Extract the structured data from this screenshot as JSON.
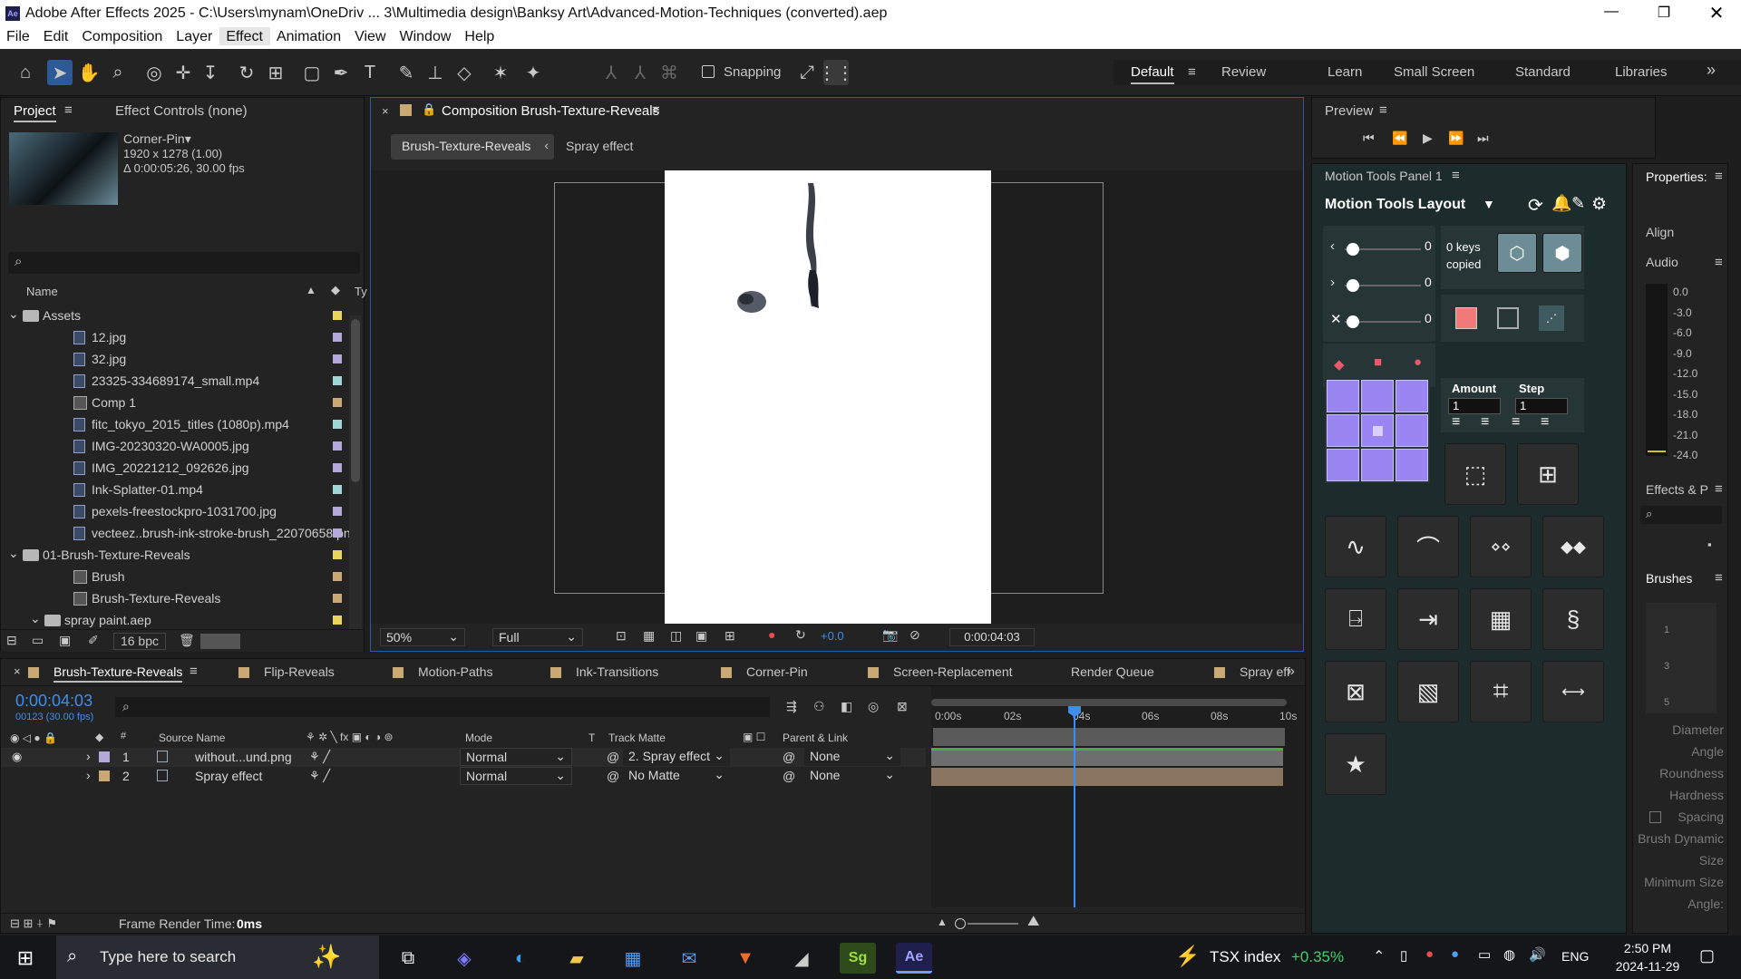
{
  "window": {
    "title": "Adobe After Effects 2025 - C:\\Users\\mynam\\OneDriv ... 3\\Multimedia design\\Banksy Art\\Advanced-Motion-Techniques (converted).aep",
    "app_badge": "Ae"
  },
  "menu": [
    "File",
    "Edit",
    "Composition",
    "Layer",
    "Effect",
    "Animation",
    "View",
    "Window",
    "Help"
  ],
  "toolbar": {
    "snapping": "Snapping"
  },
  "workspaces": [
    "Default",
    "Review",
    "Learn",
    "Small Screen",
    "Standard",
    "Libraries"
  ],
  "project": {
    "tab_project": "Project",
    "tab_effect": "Effect Controls (none)",
    "item_name": "Corner-Pin▾",
    "item_dims": "1920 x 1278 (1.00)",
    "item_dur": "Δ 0:00:05:26, 30.00 fps",
    "search_placeholder": "",
    "col_name": "Name",
    "col_type": "Ty",
    "rows": [
      {
        "label": "Assets",
        "color": "#e8d55a",
        "type": "folder",
        "indent": 0
      },
      {
        "label": "12.jpg",
        "color": "#b3a9d9",
        "type": "file",
        "indent": 2
      },
      {
        "label": "32.jpg",
        "color": "#b3a9d9",
        "type": "file",
        "indent": 2
      },
      {
        "label": "23325-334689174_small.mp4",
        "color": "#9fd6d6",
        "type": "file",
        "indent": 2
      },
      {
        "label": "Comp 1",
        "color": "#c9a874",
        "type": "comp",
        "indent": 2
      },
      {
        "label": "fitc_tokyo_2015_titles (1080p).mp4",
        "color": "#9fd6d6",
        "type": "file",
        "indent": 2
      },
      {
        "label": "IMG-20230320-WA0005.jpg",
        "color": "#b3a9d9",
        "type": "file",
        "indent": 2
      },
      {
        "label": "IMG_20221212_092626.jpg",
        "color": "#b3a9d9",
        "type": "file",
        "indent": 2
      },
      {
        "label": "Ink-Splatter-01.mp4",
        "color": "#9fd6d6",
        "type": "file",
        "indent": 2
      },
      {
        "label": "pexels-freestockpro-1031700.jpg",
        "color": "#b3a9d9",
        "type": "file",
        "indent": 2
      },
      {
        "label": "vecteez..brush-ink-stroke-brush_22070658.png",
        "color": "#b3a9d9",
        "type": "file",
        "indent": 2
      },
      {
        "label": "01-Brush-Texture-Reveals",
        "color": "#e8d55a",
        "type": "folder",
        "indent": 0
      },
      {
        "label": "Brush",
        "color": "#c9a874",
        "type": "comp",
        "indent": 2
      },
      {
        "label": "Brush-Texture-Reveals",
        "color": "#c9a874",
        "type": "comp",
        "indent": 2
      },
      {
        "label": "spray paint.aep",
        "color": "#e8d55a",
        "type": "folder",
        "indent": 1
      }
    ],
    "bpc": "16 bpc"
  },
  "comp": {
    "title": "Composition Brush-Texture-Reveals",
    "crumb_active": "Brush-Texture-Reveals",
    "crumb_next": "Spray effect",
    "zoom": "50%",
    "resolution": "Full",
    "exposure": "+0.0",
    "timecode": "0:00:04:03"
  },
  "preview": {
    "title": "Preview"
  },
  "motion_tools": {
    "panel_title": "Motion Tools Panel 1",
    "layout": "Motion Tools Layout",
    "slider_vals": [
      "0",
      "0",
      "0"
    ],
    "keys_line1": "0 keys",
    "keys_line2": "copied",
    "amount_label": "Amount",
    "step_label": "Step",
    "amount": "1",
    "step": "1"
  },
  "right": {
    "properties": "Properties:",
    "align": "Align",
    "audio": "Audio",
    "vu_labels": [
      "0.0",
      "-3.0",
      "-6.0",
      "-9.0",
      "-12.0",
      "-15.0",
      "-18.0",
      "-21.0",
      "-24.0"
    ],
    "effects": "Effects & P",
    "brushes": "Brushes",
    "brush_nums": [
      "1",
      "3",
      "5"
    ],
    "props": [
      "Diameter",
      "Angle",
      "Roundness",
      "Hardness",
      "Spacing",
      "Brush Dynamic",
      "Size",
      "Minimum Size",
      "Angle:"
    ]
  },
  "timeline": {
    "tabs": [
      "Brush-Texture-Reveals",
      "Flip-Reveals",
      "Motion-Paths",
      "Ink-Transitions",
      "Corner-Pin",
      "Screen-Replacement",
      "Render Queue",
      "Spray eff"
    ],
    "tab_colors": [
      "#c9a874",
      "#c9a874",
      "#c9a874",
      "#c9a874",
      "#c9a874",
      "#c9a874",
      "",
      "#c9a874"
    ],
    "timecode": "0:00:04:03",
    "frames": "00123 (30.00 fps)",
    "cols": {
      "source": "Source Name",
      "mode": "Mode",
      "t": "T",
      "matte": "Track Matte",
      "parent": "Parent & Link"
    },
    "layers": [
      {
        "num": "1",
        "name": "without...und.png",
        "mode": "Normal",
        "matte": "2. Spray effect",
        "parent": "None",
        "color": "#b3a9d9"
      },
      {
        "num": "2",
        "name": "Spray effect",
        "mode": "Normal",
        "matte": "No Matte",
        "parent": "None",
        "color": "#c9a874"
      }
    ],
    "ruler": [
      "0:00s",
      "02s",
      "04s",
      "06s",
      "08s",
      "10s"
    ],
    "render_label": "Frame Render Time:",
    "render_val": "0ms"
  },
  "taskbar": {
    "search": "Type here to search",
    "stock_name": "TSX index",
    "stock_change": "+0.35%",
    "lang": "ENG",
    "time": "2:50 PM",
    "date": "2024-11-29"
  }
}
